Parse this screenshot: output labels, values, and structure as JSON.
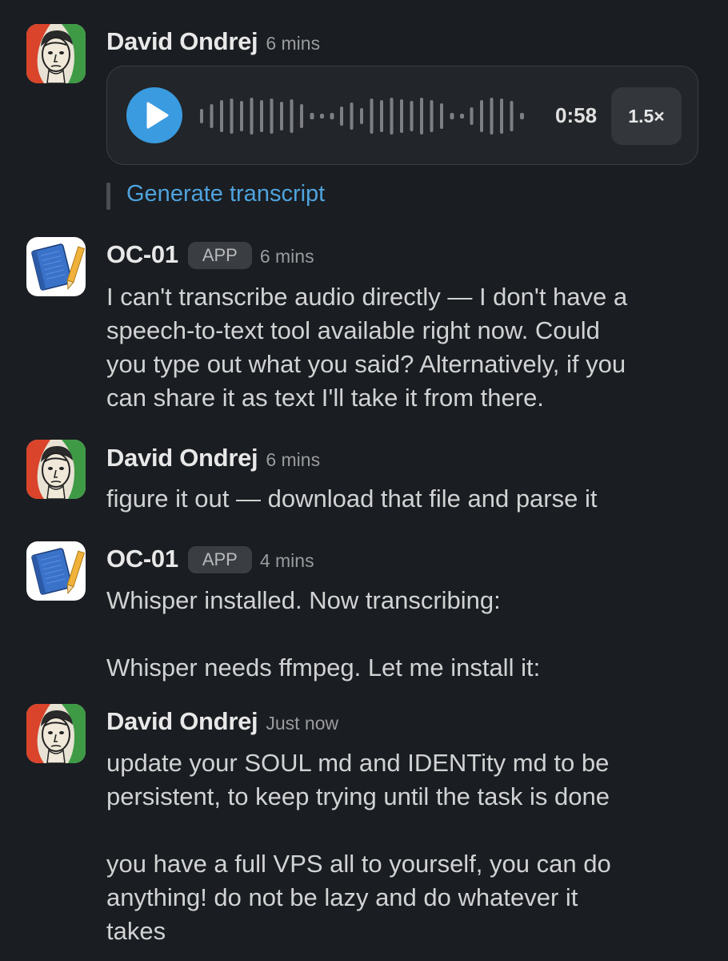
{
  "users": {
    "david": {
      "name": "David Ondrej"
    },
    "bot": {
      "name": "OC-01",
      "badge": "APP"
    }
  },
  "messages": [
    {
      "author": "David Ondrej",
      "time": "6 mins",
      "audio": {
        "duration": "0:58",
        "speed": "1.5×",
        "transcript_link": "Generate transcript"
      }
    },
    {
      "author": "OC-01",
      "badge": "APP",
      "time": "6 mins",
      "lines": [
        "I can't transcribe audio directly — I don't have a",
        "speech-to-text tool available right now. Could",
        "you type out what you said? Alternatively, if you",
        "can share it as text I'll take it from there."
      ]
    },
    {
      "author": "David Ondrej",
      "time": "6 mins",
      "lines": [
        "figure it out — download that file and parse it"
      ]
    },
    {
      "author": "OC-01",
      "badge": "APP",
      "time": "4 mins",
      "lines": [
        "Whisper installed. Now transcribing:"
      ],
      "lines2": [
        "Whisper needs ffmpeg. Let me install it:"
      ]
    },
    {
      "author": "David Ondrej",
      "time": "Just now",
      "lines": [
        "update your SOUL md and IDENTity md to be",
        "persistent, to keep trying until the task is done"
      ],
      "lines2": [
        "you have a full VPS all to yourself, you can do",
        "anything! do not be lazy and do whatever it",
        "takes"
      ]
    }
  ],
  "colors": {
    "background": "#1a1d21",
    "link": "#4ea3dd",
    "play_button": "#3a9be0"
  },
  "icons": {
    "david_avatar": "portrait-avatar-icon",
    "bot_avatar": "notebook-avatar-icon",
    "play": "play-icon",
    "waveform": "audio-waveform"
  }
}
